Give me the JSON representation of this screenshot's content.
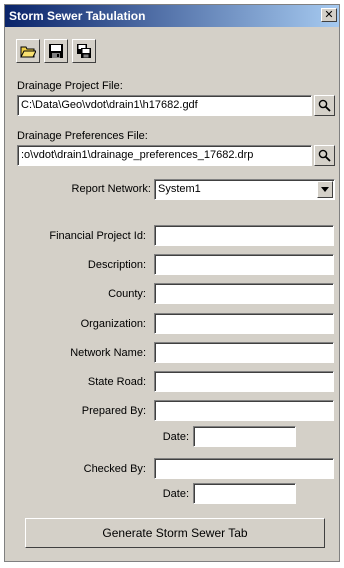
{
  "window": {
    "title": "Storm Sewer Tabulation",
    "close_glyph": "✕"
  },
  "toolbar": {
    "buttons": [
      {
        "icon": "open-folder-icon"
      },
      {
        "icon": "save-icon"
      },
      {
        "icon": "save-all-icon"
      }
    ]
  },
  "project_file": {
    "label": "Drainage Project File:",
    "value": "C:\\Data\\Geo\\vdot\\drain1\\h17682.gdf"
  },
  "preferences_file": {
    "label": "Drainage Preferences File:",
    "value": ":o\\vdot\\drain1\\drainage_preferences_17682.drp"
  },
  "report_network": {
    "label": "Report Network:",
    "value": "System1"
  },
  "form": {
    "financial_project_id": {
      "label": "Financial Project Id:",
      "value": ""
    },
    "description": {
      "label": "Description:",
      "value": ""
    },
    "county": {
      "label": "County:",
      "value": ""
    },
    "organization": {
      "label": "Organization:",
      "value": ""
    },
    "network_name": {
      "label": "Network Name:",
      "value": ""
    },
    "state_road": {
      "label": "State Road:",
      "value": ""
    },
    "prepared_by": {
      "label": "Prepared By:",
      "value": ""
    },
    "prepared_date": {
      "label": "Date:",
      "value": ""
    },
    "checked_by": {
      "label": "Checked By:",
      "value": ""
    },
    "checked_date": {
      "label": "Date:",
      "value": ""
    }
  },
  "generate_button": {
    "label": "Generate Storm Sewer Tab"
  }
}
